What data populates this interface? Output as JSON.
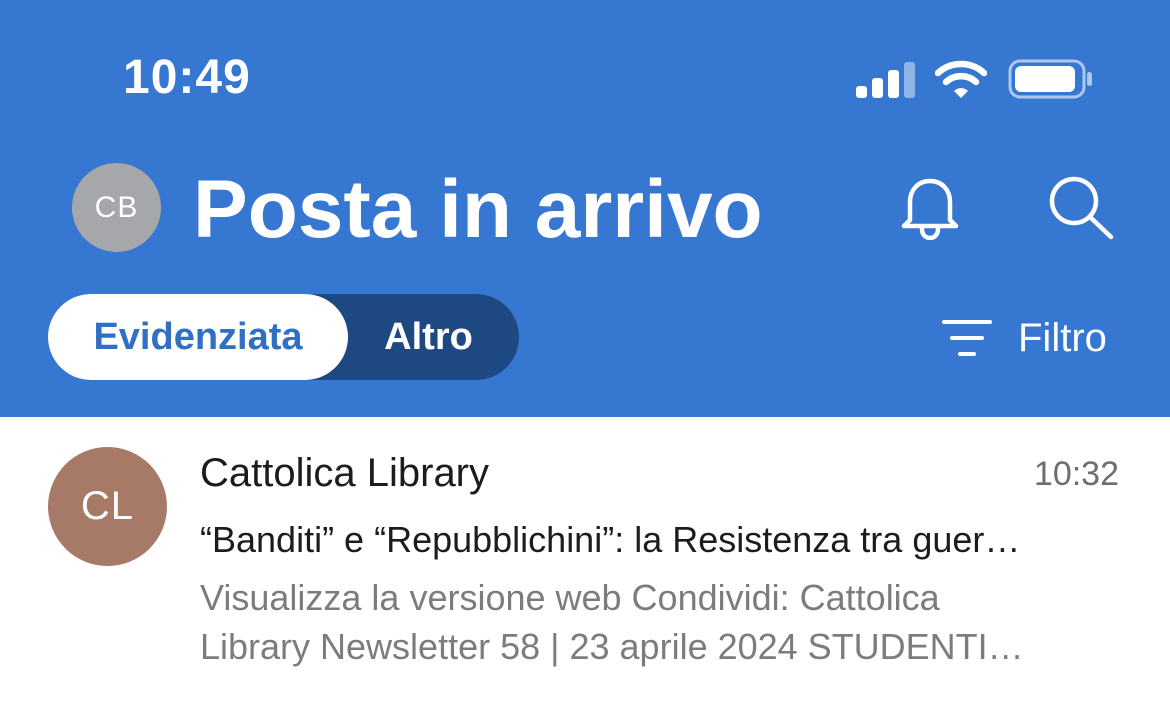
{
  "status_bar": {
    "time": "10:49",
    "icons": [
      "cellular-signal-icon",
      "wifi-icon",
      "battery-icon"
    ]
  },
  "header": {
    "avatar_initials": "CB",
    "title": "Posta in arrivo",
    "bell_icon": "bell-icon",
    "search_icon": "search-icon",
    "tabs": [
      {
        "label": "Evidenziata",
        "selected": true
      },
      {
        "label": "Altro",
        "selected": false
      }
    ],
    "filter_label": "Filtro",
    "filter_icon": "filter-icon"
  },
  "messages": [
    {
      "avatar_initials": "CL",
      "sender": "Cattolica Library",
      "time": "10:32",
      "subject": "“Banditi” e “Repubblichini”: la Resistenza tra guer…",
      "preview_line1": "Visualizza la versione web Condividi: Cattolica",
      "preview_line2": "Library Newsletter 58 | 23 aprile 2024 STUDENTI…"
    }
  ],
  "colors": {
    "header_bg": "#3577d1",
    "segment_bg": "#1d4882",
    "segment_active_text": "#2f6fc4",
    "my_avatar_bg": "#a6a7aa",
    "sender_avatar_bg": "#a77a67"
  }
}
